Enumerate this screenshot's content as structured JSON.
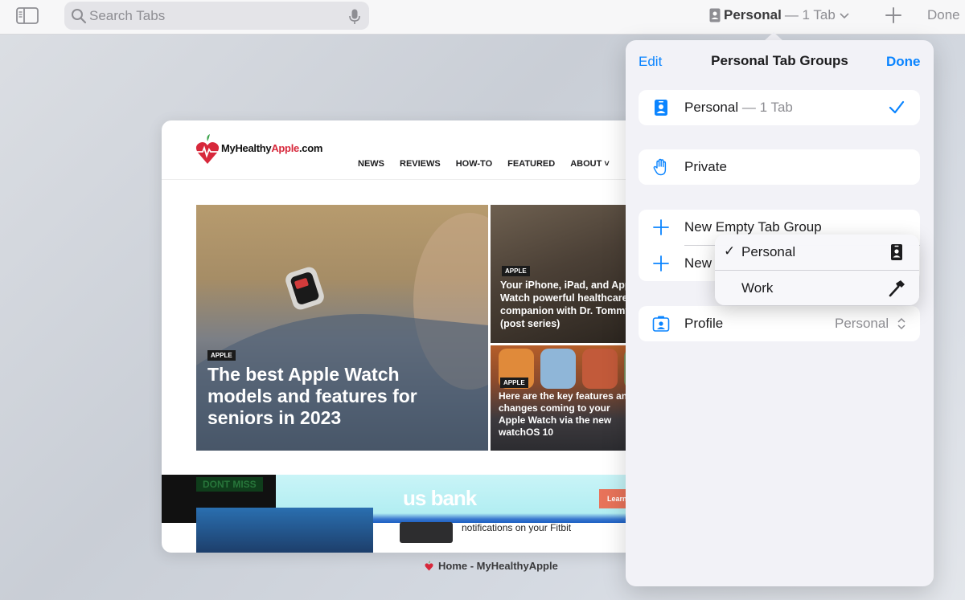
{
  "toolbar": {
    "search_placeholder": "Search Tabs",
    "group_name": "Personal",
    "group_count": "— 1 Tab",
    "done_label": "Done"
  },
  "tab": {
    "site_logo_prefix": "MyHealthy",
    "site_logo_highlight": "Apple",
    "site_logo_suffix": ".com",
    "nav": [
      "NEWS",
      "REVIEWS",
      "HOW-TO",
      "FEATURED",
      "ABOUT ˅"
    ],
    "hero_badge": "APPLE",
    "hero_title": "The best Apple Watch models and features for seniors in 2023",
    "side1_badge": "APPLE",
    "side1_title": "Your iPhone, iPad, and Apple Watch powerful healthcare companion with Dr. Tommy Korn (post series)",
    "side2_badge": "APPLE",
    "side2_title": "Here are the key features and changes coming to your Apple Watch via the new watchOS 10",
    "dont_miss": "DONT MISS",
    "ad_brand": "us bank",
    "ad_button": "Learn",
    "bottom_text": "notifications on your Fitbit",
    "caption": "Home - MyHealthyApple"
  },
  "popover": {
    "edit_label": "Edit",
    "title": "Personal Tab Groups",
    "done_label": "Done",
    "current_group_name": "Personal",
    "current_group_count": "— 1 Tab",
    "private_label": "Private",
    "new_empty_label": "New Empty Tab Group",
    "new_label": "New",
    "profile_label": "Profile",
    "profile_value": "Personal"
  },
  "context_menu": {
    "items": [
      {
        "label": "Personal",
        "checked": "✓",
        "icon": "id-badge-icon"
      },
      {
        "label": "Work",
        "checked": "",
        "icon": "hammer-icon"
      }
    ]
  },
  "colors": {
    "accent": "#0a84ff",
    "brand_red": "#d7283b"
  }
}
